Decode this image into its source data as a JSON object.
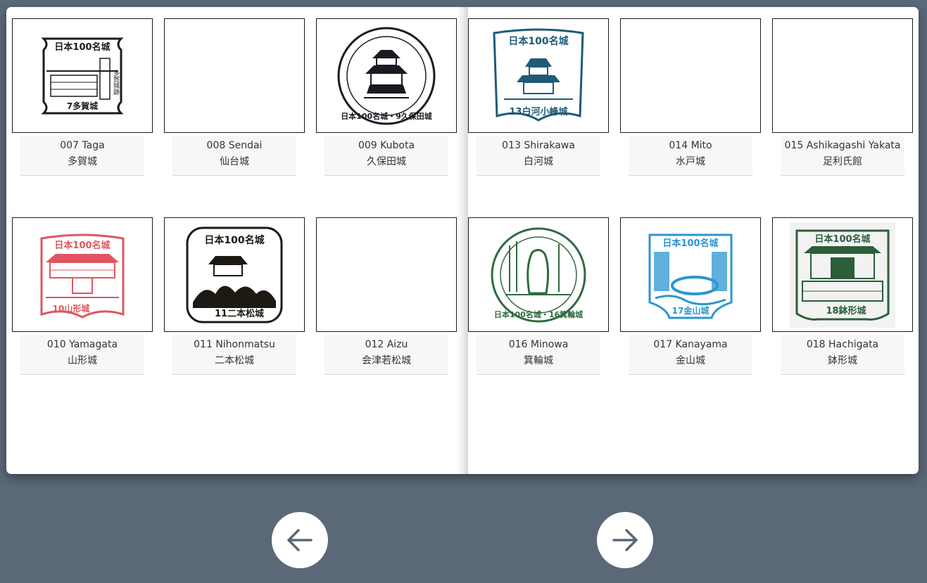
{
  "stamps": [
    {
      "number": "007 Taga",
      "japanese": "多賀城",
      "has_stamp": true,
      "stamp_color": "#1c1c1c",
      "stamp_label": "7多賀城",
      "header": "日本100名城",
      "side_label": "多賀城跡"
    },
    {
      "number": "008 Sendai",
      "japanese": "仙台城",
      "has_stamp": false
    },
    {
      "number": "009 Kubota",
      "japanese": "久保田城",
      "has_stamp": true,
      "stamp_color": "#1a1a22",
      "stamp_label": "日本100名城・9久保田城"
    },
    {
      "number": "013 Shirakawa",
      "japanese": "白河城",
      "has_stamp": true,
      "stamp_color": "#1f5a78",
      "stamp_label": "13白河小峰城",
      "header": "日本100名城"
    },
    {
      "number": "014 Mito",
      "japanese": "水戸城",
      "has_stamp": false
    },
    {
      "number": "015 Ashikagashi Yakata",
      "japanese": "足利氏館",
      "has_stamp": false
    },
    {
      "number": "010 Yamagata",
      "japanese": "山形城",
      "has_stamp": true,
      "stamp_color": "#e05560",
      "stamp_label": "10山形城",
      "header": "日本100名城"
    },
    {
      "number": "011 Nihonmatsu",
      "japanese": "二本松城",
      "has_stamp": true,
      "stamp_color": "#1c1a12",
      "stamp_label": "11二本松城",
      "header": "日本100名城"
    },
    {
      "number": "012 Aizu",
      "japanese": "会津若松城",
      "has_stamp": false
    },
    {
      "number": "016 Minowa",
      "japanese": "箕輪城",
      "has_stamp": true,
      "stamp_color": "#2f6b3f",
      "stamp_label": "日本100名城・16箕輪城"
    },
    {
      "number": "017 Kanayama",
      "japanese": "金山城",
      "has_stamp": true,
      "stamp_color": "#2a96d0",
      "stamp_label": "17金山城",
      "header": "日本100名城"
    },
    {
      "number": "018 Hachigata",
      "japanese": "鉢形城",
      "has_stamp": true,
      "stamp_color": "#2c5e3a",
      "stamp_label": "18鉢形城",
      "header": "日本100名城"
    }
  ],
  "navigation": {
    "prev_icon": "arrow-left-icon",
    "next_icon": "arrow-right-icon",
    "icon_color": "#5a6878"
  }
}
